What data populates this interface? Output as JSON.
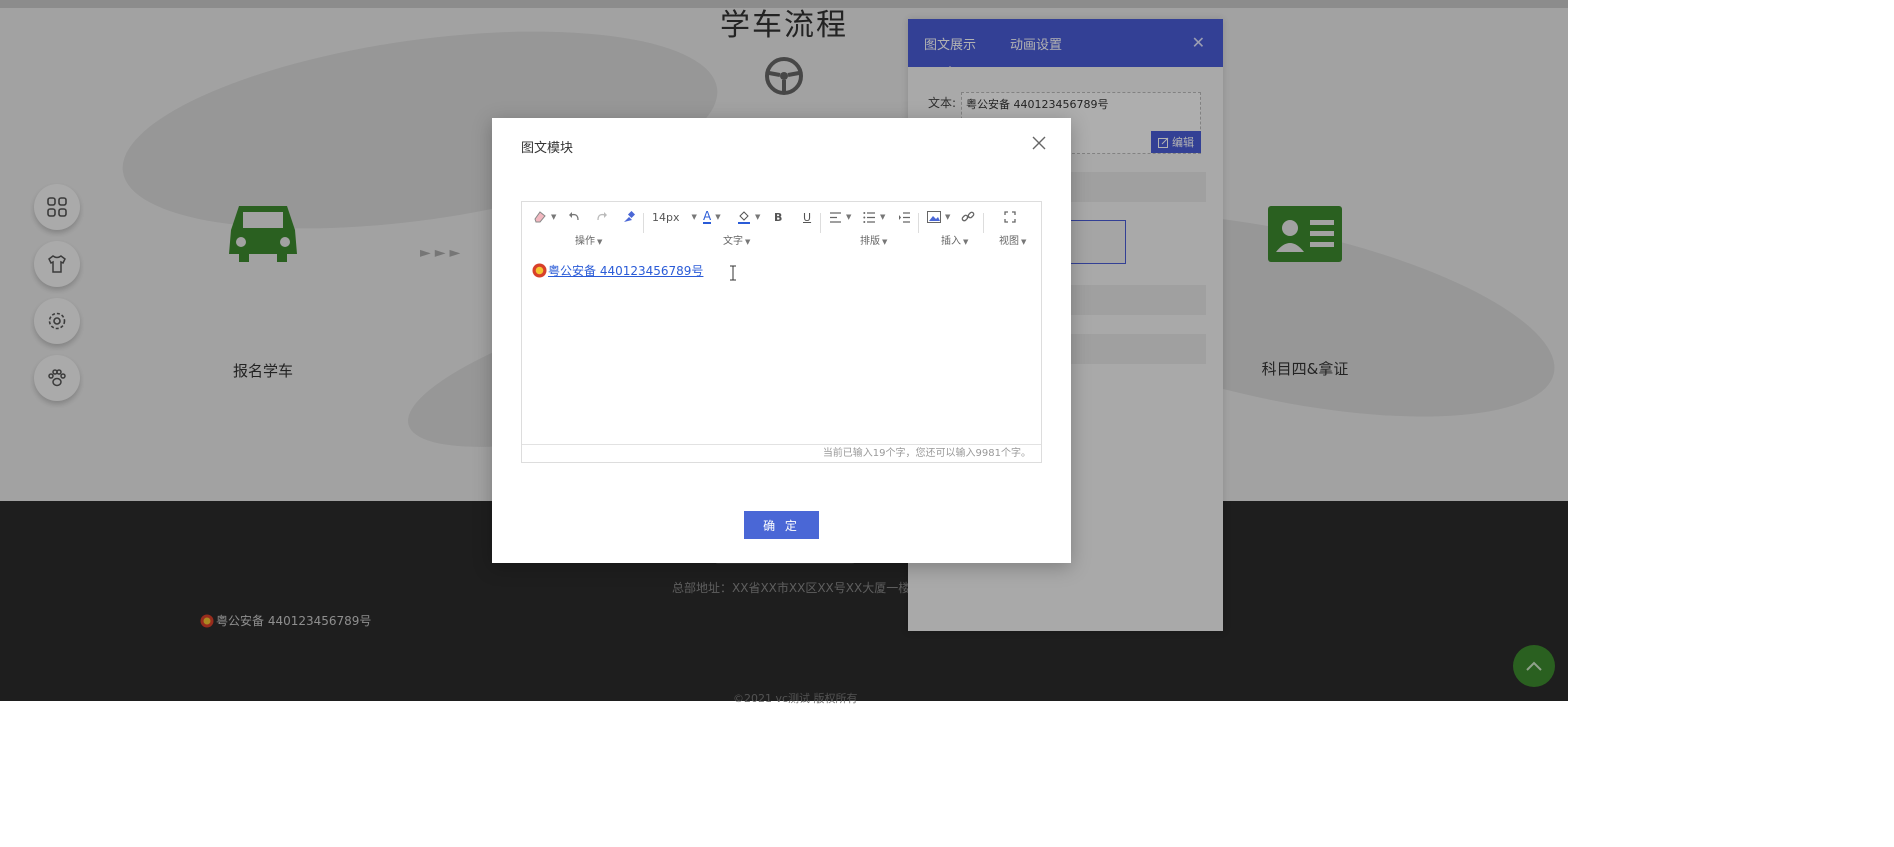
{
  "page": {
    "title": "学车流程",
    "steps": [
      {
        "label": "报名学车"
      },
      {
        "label": "科目四&拿证"
      }
    ]
  },
  "footer": {
    "address": "总部地址：XX省XX市XX区XX号XX大厦一楼",
    "icp": "粤公安备 440123456789号",
    "copyright": "©2021 vc测试 版权所有"
  },
  "panel": {
    "tabs": [
      "图文展示",
      "动画设置"
    ],
    "text_label": "文本:",
    "text_value": "粤公安备 440123456789号",
    "edit_label": "编辑"
  },
  "modal": {
    "title": "图文模块",
    "confirm_label": "确 定",
    "toolbar": {
      "font_size": "14px",
      "groups": [
        "操作",
        "文字",
        "排版",
        "插入",
        "视图"
      ]
    },
    "content_link": "粤公安备 440123456789号",
    "status": "当前已输入19个字，您还可以输入9981个字。"
  },
  "colors": {
    "accent": "#4a5cd6",
    "green": "#3d8a2e",
    "link": "#2a5bd7"
  }
}
